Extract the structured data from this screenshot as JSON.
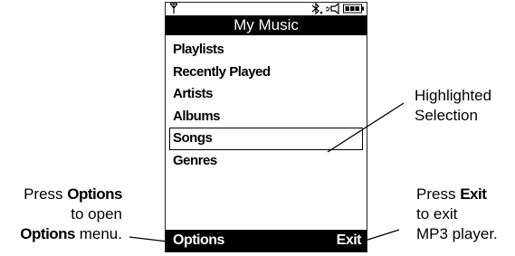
{
  "screen": {
    "title": "My Music",
    "menu_items": [
      "Playlists",
      "Recently Played",
      "Artists",
      "Albums",
      "Songs",
      "Genres"
    ],
    "selected_index": 4,
    "softkeys": {
      "left": "Options",
      "right": "Exit"
    },
    "status_icons": [
      "signal-icon",
      "bluetooth-icon",
      "ringer-icon",
      "battery-icon"
    ]
  },
  "callouts": {
    "highlight": [
      "Highlighted",
      "Selection"
    ],
    "options": {
      "line1_prefix": "Press ",
      "line1_bold": "Options",
      "line2": "to open",
      "line3_bold": "Options",
      "line3_suffix": " menu."
    },
    "exit": {
      "line1_prefix": "Press ",
      "line1_bold": "Exit",
      "line2": "to exit",
      "line3": "MP3 player."
    }
  }
}
